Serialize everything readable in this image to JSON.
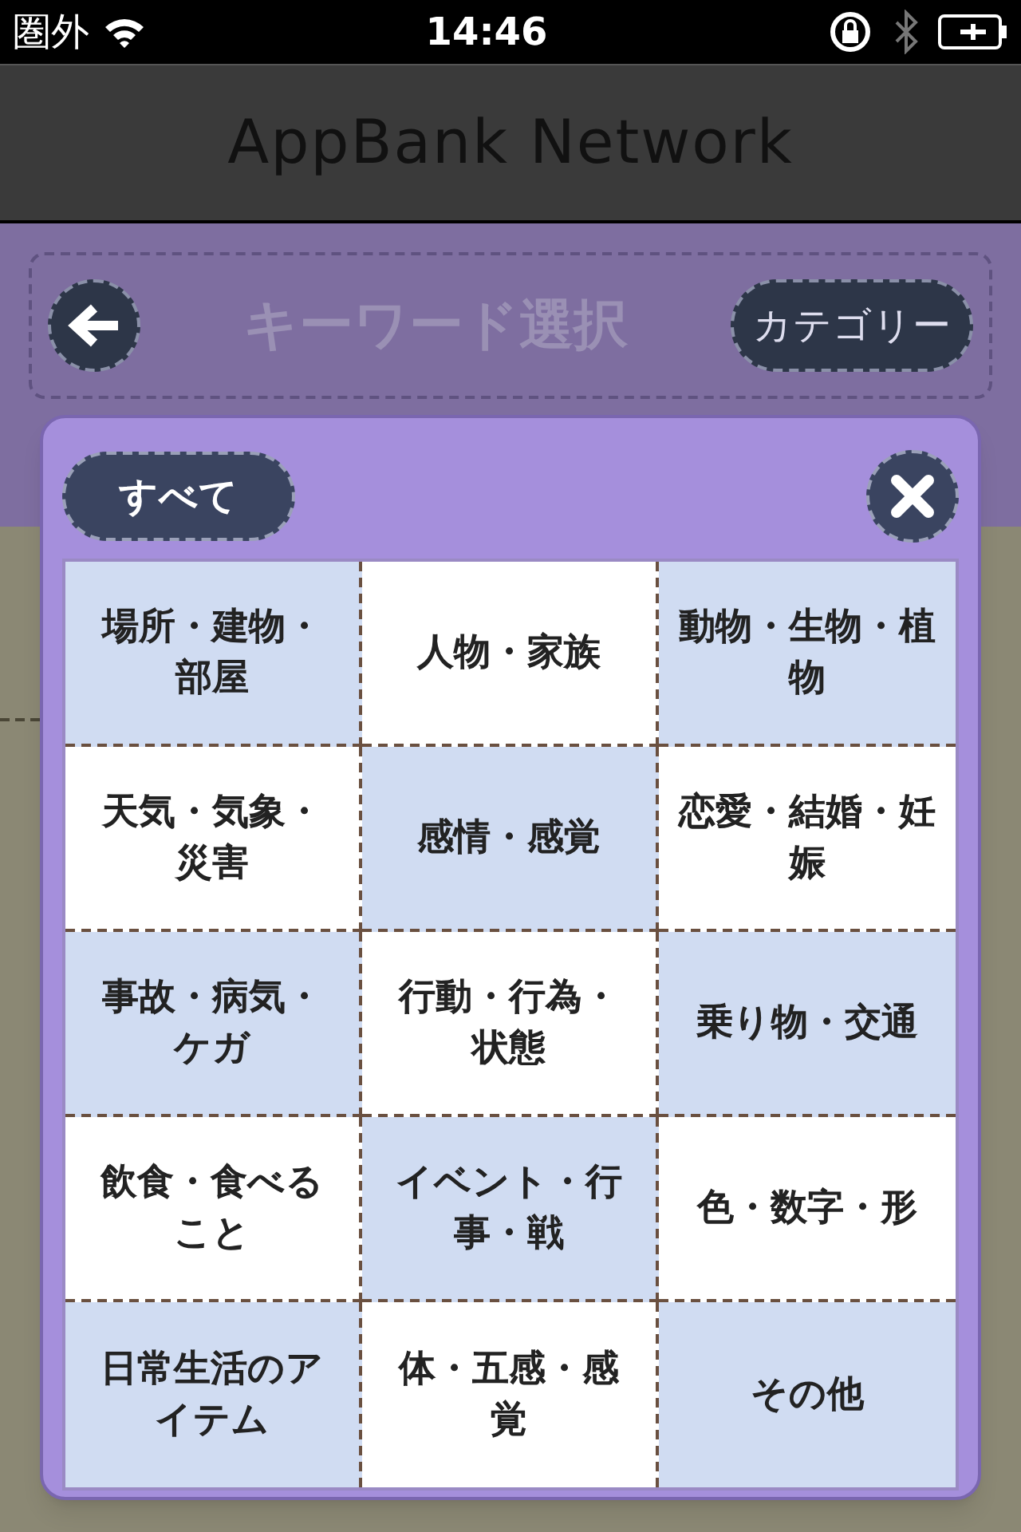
{
  "status_bar": {
    "carrier": "圏外",
    "time": "14:46"
  },
  "title_bar": {
    "title": "AppBank Network"
  },
  "header": {
    "title": "キーワード選択",
    "category_button": "カテゴリー"
  },
  "popover": {
    "all_button": "すべて",
    "categories": [
      {
        "label": "場所・建物・部屋",
        "shaded": true
      },
      {
        "label": "人物・家族",
        "shaded": false
      },
      {
        "label": "動物・生物・植物",
        "shaded": true
      },
      {
        "label": "天気・気象・災害",
        "shaded": false
      },
      {
        "label": "感情・感覚",
        "shaded": true
      },
      {
        "label": "恋愛・結婚・妊娠",
        "shaded": false
      },
      {
        "label": "事故・病気・ケガ",
        "shaded": true
      },
      {
        "label": "行動・行為・状態",
        "shaded": false
      },
      {
        "label": "乗り物・交通",
        "shaded": true
      },
      {
        "label": "飲食・食べること",
        "shaded": false
      },
      {
        "label": "イベント・行事・戦",
        "shaded": true
      },
      {
        "label": "色・数字・形",
        "shaded": false
      },
      {
        "label": "日常生活のアイテム",
        "shaded": true
      },
      {
        "label": "体・五感・感覚",
        "shaded": false
      },
      {
        "label": "その他",
        "shaded": true
      }
    ]
  }
}
